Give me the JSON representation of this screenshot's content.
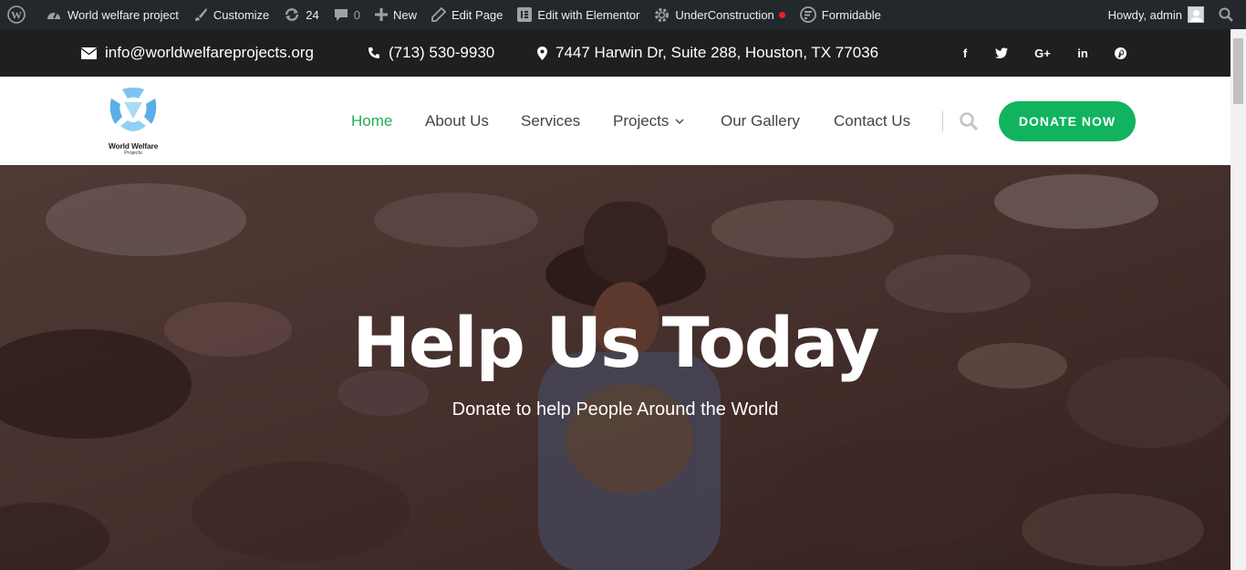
{
  "adminbar": {
    "site_name": "World welfare project",
    "customize": "Customize",
    "updates_count": "24",
    "comments_count": "0",
    "new": "New",
    "edit_page": "Edit Page",
    "elementor": "Edit with Elementor",
    "under_construction": "UnderConstruction",
    "formidable": "Formidable",
    "howdy": "Howdy, admin"
  },
  "topbar": {
    "email": "info@worldwelfareprojects.org",
    "phone": "(713) 530-9930",
    "address": "7447 Harwin Dr, Suite 288, Houston, TX 77036",
    "social": [
      "f",
      "t",
      "G+",
      "in",
      "p"
    ]
  },
  "logo": {
    "title": "World Welfare",
    "subtitle": "Projects"
  },
  "nav": {
    "home": "Home",
    "about": "About Us",
    "services": "Services",
    "projects": "Projects",
    "gallery": "Our Gallery",
    "contact": "Contact Us",
    "donate": "DONATE NOW"
  },
  "hero": {
    "title": "Help Us Today",
    "subtitle": "Donate to help People Around the World"
  },
  "colors": {
    "accent": "#1fae5b",
    "donate_bg": "#12b35e",
    "adminbar_bg": "#23282d",
    "topbar_bg": "#1f1f1f"
  }
}
